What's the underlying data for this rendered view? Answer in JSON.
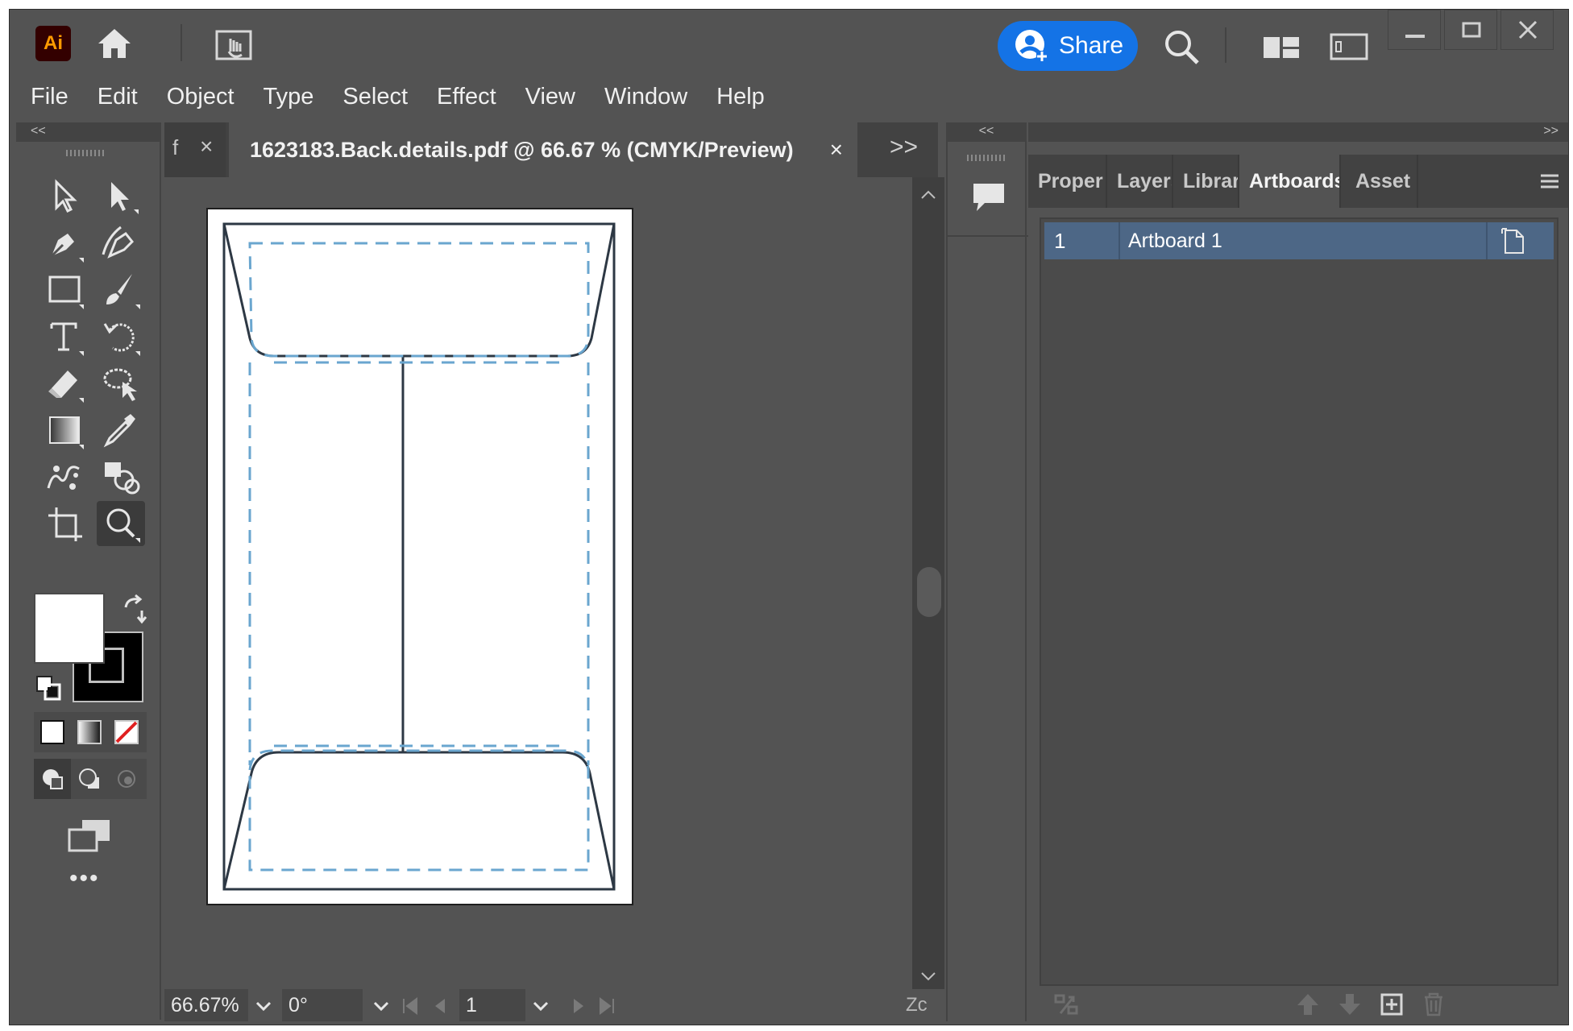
{
  "app": {
    "logo_text": "Ai",
    "share_label": "Share",
    "accent_color": "#1473e6"
  },
  "menu": [
    "File",
    "Edit",
    "Object",
    "Type",
    "Select",
    "Effect",
    "View",
    "Window",
    "Help"
  ],
  "document": {
    "prev_tab_label": "f",
    "active_tab_label": "1623183.Back.details.pdf @ 66.67 % (CMYK/Preview)",
    "close_glyph": "×",
    "more_glyph": ">>"
  },
  "collapse": {
    "left": "<<",
    "strip": "<<",
    "right": ">>"
  },
  "tools": [
    "selection-tool",
    "direct-selection-tool",
    "pen-tool",
    "curvature-tool",
    "rectangle-tool",
    "paintbrush-tool",
    "type-tool",
    "rotate-tool",
    "eraser-tool",
    "lasso-tool",
    "gradient-tool",
    "eyedropper-tool",
    "puppet-warp-tool",
    "shape-builder-tool",
    "artboard-tool",
    "zoom-tool"
  ],
  "active_tool": "zoom-tool",
  "colors": {
    "fill": "#ffffff",
    "stroke": "#000000",
    "artboard_line": "#2d3844",
    "dashed_line": "#6aa6cf",
    "selected_row": "#4d6786"
  },
  "status": {
    "zoom": "66.67%",
    "rotation": "0°",
    "artboard_number": "1",
    "truncated_label": "Zc"
  },
  "panel": {
    "tabs": [
      "Proper",
      "Layers",
      "Librari",
      "Artboards",
      "Asset E"
    ],
    "active_tab": "Artboards",
    "artboards": [
      {
        "number": "1",
        "name": "Artboard 1"
      }
    ]
  }
}
